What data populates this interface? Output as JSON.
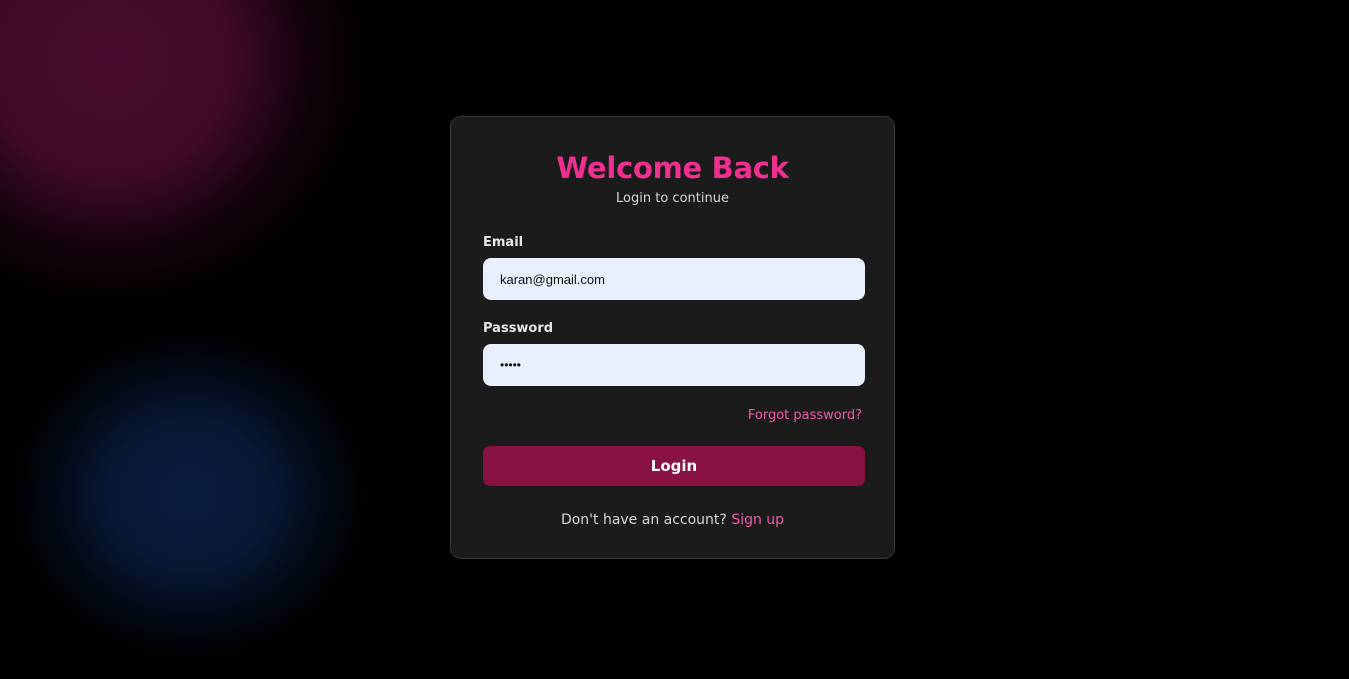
{
  "colors": {
    "background": "#000000",
    "card": "#1b1b1c",
    "accent_pink": "#f0308f",
    "button": "#881242",
    "input_bg": "#e8f0fe",
    "glow_pink": "#4a1030",
    "glow_blue": "#0a1c3f"
  },
  "login": {
    "title": "Welcome Back",
    "subtitle": "Login to continue",
    "email_label": "Email",
    "email_value": "karan@gmail.com",
    "password_label": "Password",
    "password_value": "•••••",
    "forgot_link": "Forgot password?",
    "login_button": "Login",
    "signup_prompt": "Don't have an account?",
    "signup_link": "Sign up"
  }
}
